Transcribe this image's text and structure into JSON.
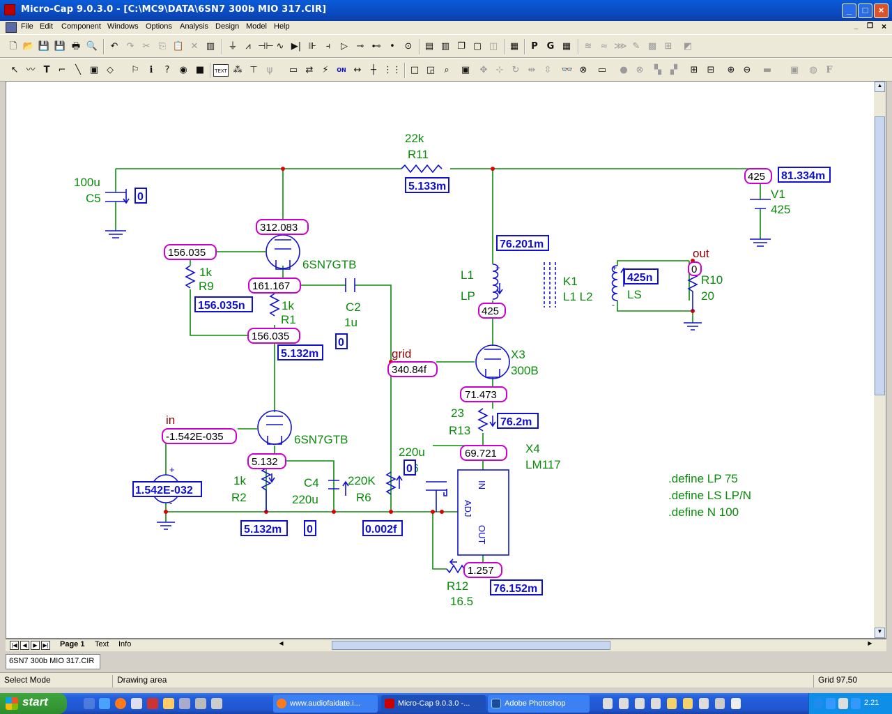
{
  "window": {
    "title": "Micro-Cap 9.0.3.0 - [C:\\MC9\\DATA\\6SN7  300b MIO 317.CIR]"
  },
  "menu": [
    "File",
    "Edit",
    "Component",
    "Windows",
    "Options",
    "Analysis",
    "Design",
    "Model",
    "Help"
  ],
  "toolbar1": {
    "icons": [
      "new-icon",
      "open-icon",
      "save-icon",
      "save-all-icon",
      "print-icon",
      "print-preview-icon",
      "undo-icon",
      "redo-icon",
      "cut-icon",
      "copy-icon",
      "paste-icon",
      "delete-icon",
      "clear-icon",
      "ground-icon",
      "resistor-icon",
      "capacitor-icon",
      "inductor-icon",
      "diode-icon",
      "battery-icon",
      "npn-icon",
      "opamp-icon",
      "switch-icon",
      "source-icon",
      "dot-icon",
      "tile-h-icon",
      "tile-v-icon",
      "cascade-icon",
      "window-icon",
      "split-icon",
      "calc-icon",
      "page-p-icon",
      "page-g-icon",
      "grid-table-icon"
    ],
    "glyphs": {
      "page_p": "P",
      "page_g": "G"
    }
  },
  "toolbar2": {
    "glyphs": {
      "text_tool": "T",
      "text_mode": "TEXT",
      "font": "F",
      "info": "i",
      "on": "ON"
    }
  },
  "schematic": {
    "labels": {
      "r11_value": "22k",
      "r11_name": "R11",
      "c5_value": "100u",
      "c5_name": "C5",
      "v1_name": "V1",
      "v1_value": "425",
      "tube1": "6SN7GTB",
      "tube2": "6SN7GTB",
      "r9_value": "1k",
      "r9_name": "R9",
      "r1_value": "1k",
      "r1_name": "R1",
      "c2_name": "C2",
      "c2_value": "1u",
      "l1_name": "L1",
      "l1_lp": "LP",
      "k1_name": "K1",
      "k1_value": "L1 L2",
      "ls_label": "LS",
      "out_node": "out",
      "r10_name": "R10",
      "r10_value": "20",
      "grid_node": "grid",
      "x3_name": "X3",
      "x3_value": "300B",
      "r13_value": "23",
      "r13_name": "R13",
      "x4_name": "X4",
      "x4_value": "LM117",
      "in_node": "in",
      "r2_value": "1k",
      "r2_name": "R2",
      "c4_name": "C4",
      "c4_value": "220u",
      "r6_value": "220K",
      "r6_name": "R6",
      "c6_value": "220u",
      "c6_name": "C6",
      "r12_name": "R12",
      "r12_value": "16.5",
      "lm_in": "IN",
      "lm_adj": "ADJ",
      "lm_out": "OUT",
      "src_plus": "+",
      "src_minus": "-",
      "l1_plus": "+",
      "ls_plus": "+",
      "ls_minus": "-"
    },
    "defines": [
      ".define LP 75",
      ".define LS LP/N",
      ".define N 100"
    ],
    "voltages": {
      "v_top": "312.083",
      "v_grid1": "156.035",
      "v_cath1": "161.167",
      "v_mid": "156.035",
      "v_l1": "425",
      "v_v1": "425",
      "v_out": "0",
      "v_grid": "340.84f",
      "v_cath3": "71.473",
      "v_x4in": "69.721",
      "v_cath2": "5.132",
      "v_in": "-1.542E-035",
      "v_x4out": "1.257"
    },
    "currents": {
      "i_r11": "5.133m",
      "i_c5": "0",
      "i_v1": "81.334m",
      "i_l1": "76.201m",
      "i_ls": "425n",
      "i_r9": "156.035n",
      "i_r1": "5.132m",
      "i_c2": "0",
      "i_r13": "76.2m",
      "i_src": "1.542E-032",
      "i_r2": "5.132m",
      "i_c4": "0",
      "i_r6": "0.002f",
      "i_c6": "0",
      "i_r12": "76.152m"
    }
  },
  "tabs": {
    "page": "Page 1",
    "text": "Text",
    "info": "Info"
  },
  "doc_tab": "6SN7  300b MIO 317.CIR",
  "status": {
    "mode": "Select Mode",
    "area": "Drawing area",
    "grid": "Grid 97,50"
  },
  "taskbar": {
    "start": "start",
    "tasks": [
      "www.audiofaidate.i...",
      "Micro-Cap 9.0.3.0 -...",
      "Adobe Photoshop"
    ],
    "clock": "2.21"
  },
  "colors": {
    "wire": "#0a8a0a",
    "component": "#1010d0",
    "node_box": "#cc00cc",
    "junction": "#e00000",
    "desktop": "#245edb"
  }
}
